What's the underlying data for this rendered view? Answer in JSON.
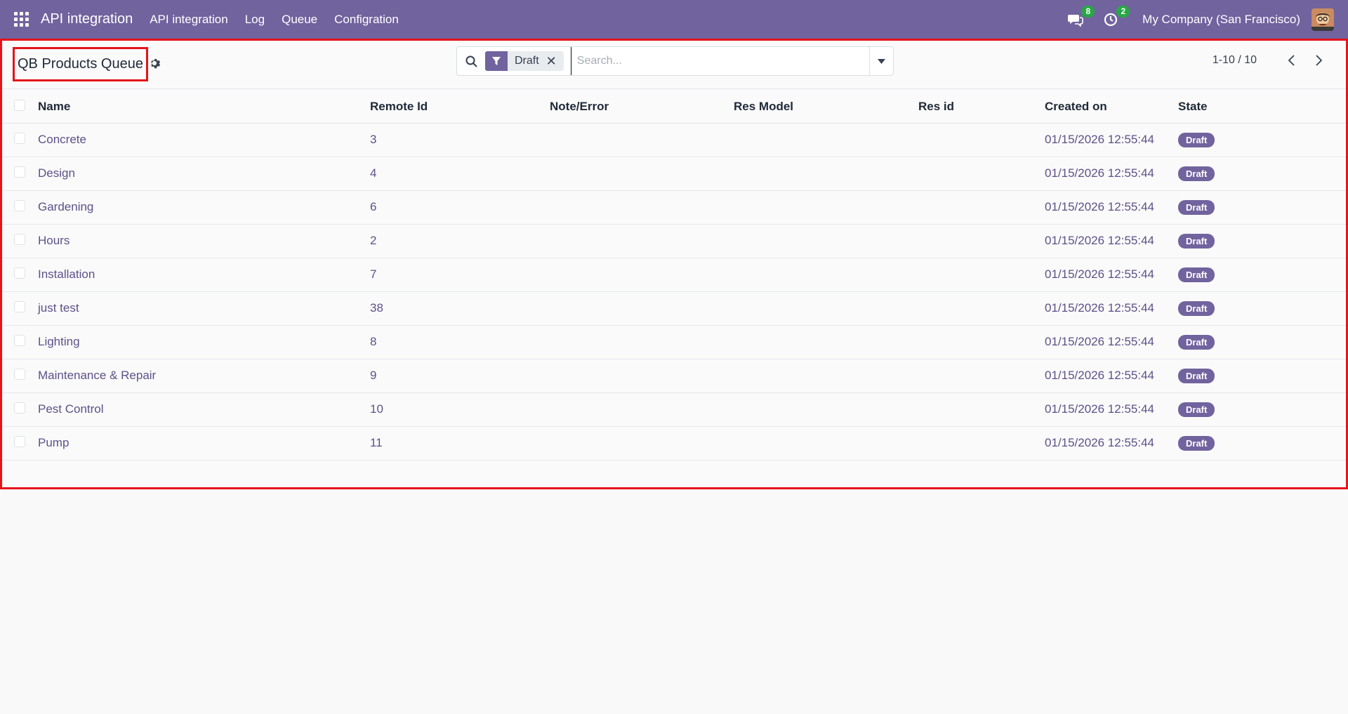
{
  "navbar": {
    "brand": "API integration",
    "menu": [
      "API integration",
      "Log",
      "Queue",
      "Configration"
    ],
    "messages_count": "8",
    "activities_count": "2",
    "company": "My Company (San Francisco)"
  },
  "control_panel": {
    "title": "QB Products Queue",
    "facet_label": "Draft",
    "search_placeholder": "Search...",
    "pager": "1-10 / 10"
  },
  "table": {
    "columns": [
      "Name",
      "Remote Id",
      "Note/Error",
      "Res Model",
      "Res id",
      "Created on",
      "State"
    ],
    "rows": [
      {
        "name": "Concrete",
        "remote_id": "3",
        "note": "",
        "res_model": "",
        "res_id": "",
        "created_on": "01/15/2026 12:55:44",
        "state": "Draft"
      },
      {
        "name": "Design",
        "remote_id": "4",
        "note": "",
        "res_model": "",
        "res_id": "",
        "created_on": "01/15/2026 12:55:44",
        "state": "Draft"
      },
      {
        "name": "Gardening",
        "remote_id": "6",
        "note": "",
        "res_model": "",
        "res_id": "",
        "created_on": "01/15/2026 12:55:44",
        "state": "Draft"
      },
      {
        "name": "Hours",
        "remote_id": "2",
        "note": "",
        "res_model": "",
        "res_id": "",
        "created_on": "01/15/2026 12:55:44",
        "state": "Draft"
      },
      {
        "name": "Installation",
        "remote_id": "7",
        "note": "",
        "res_model": "",
        "res_id": "",
        "created_on": "01/15/2026 12:55:44",
        "state": "Draft"
      },
      {
        "name": "just test",
        "remote_id": "38",
        "note": "",
        "res_model": "",
        "res_id": "",
        "created_on": "01/15/2026 12:55:44",
        "state": "Draft"
      },
      {
        "name": "Lighting",
        "remote_id": "8",
        "note": "",
        "res_model": "",
        "res_id": "",
        "created_on": "01/15/2026 12:55:44",
        "state": "Draft"
      },
      {
        "name": "Maintenance & Repair",
        "remote_id": "9",
        "note": "",
        "res_model": "",
        "res_id": "",
        "created_on": "01/15/2026 12:55:44",
        "state": "Draft"
      },
      {
        "name": "Pest Control",
        "remote_id": "10",
        "note": "",
        "res_model": "",
        "res_id": "",
        "created_on": "01/15/2026 12:55:44",
        "state": "Draft"
      },
      {
        "name": "Pump",
        "remote_id": "11",
        "note": "",
        "res_model": "",
        "res_id": "",
        "created_on": "01/15/2026 12:55:44",
        "state": "Draft"
      }
    ]
  },
  "colors": {
    "navbar": "#71639e",
    "highlight": "#e5141a",
    "badge_green": "#28a745",
    "link": "#5e5088"
  },
  "icons": [
    "apps-grid-icon",
    "chat-icon",
    "clock-icon",
    "gear-icon",
    "search-icon",
    "filter-icon",
    "close-icon",
    "caret-down-icon",
    "chevron-left-icon",
    "chevron-right-icon"
  ]
}
